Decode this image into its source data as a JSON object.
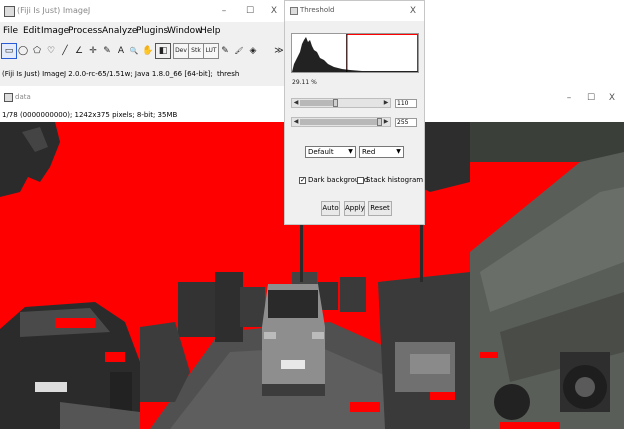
{
  "main_window": {
    "title": "(Fiji Is Just) ImageJ",
    "window_controls": {
      "minimize": "–",
      "maximize": "☐",
      "close": "X"
    },
    "menu": [
      "File",
      "Edit",
      "Image",
      "Process",
      "Analyze",
      "Plugins",
      "Window",
      "Help"
    ],
    "toolbar": {
      "tools": [
        {
          "name": "rectangle-tool-icon",
          "glyph": "▭"
        },
        {
          "name": "oval-tool-icon",
          "glyph": "◯"
        },
        {
          "name": "polygon-tool-icon",
          "glyph": "⬠"
        },
        {
          "name": "freehand-tool-icon",
          "glyph": "♡"
        },
        {
          "name": "line-tool-icon",
          "glyph": "╱"
        },
        {
          "name": "angle-tool-icon",
          "glyph": "∠"
        },
        {
          "name": "point-tool-icon",
          "glyph": "✛"
        },
        {
          "name": "wand-tool-icon",
          "glyph": "✎"
        },
        {
          "name": "text-tool-icon",
          "glyph": "A"
        },
        {
          "name": "magnifier-tool-icon",
          "glyph": "🔍"
        },
        {
          "name": "hand-tool-icon",
          "glyph": "✋"
        },
        {
          "name": "color-picker-tool-icon",
          "glyph": "◧"
        }
      ],
      "dev_label": "Dev",
      "stk_label": "Stk",
      "lut_label": "LUT",
      "pencil_glyph": "✎",
      "brush_glyph": "🖌",
      "flood_glyph": "◈",
      "more_glyph": "≫"
    },
    "status": {
      "version": "(Fiji Is Just) ImageJ 2.0.0-rc-65/1.51w; Java 1.8.0_66 [64-bit];",
      "tool": "thresh"
    }
  },
  "image_window": {
    "title": "data",
    "info": "1/78 (0000000000); 1242x375 pixels; 8-bit; 35MB",
    "window_controls": {
      "minimize": "–",
      "maximize": "☐",
      "close": "X"
    }
  },
  "threshold_dialog": {
    "title": "Threshold",
    "close": "X",
    "percentage": "29.11 %",
    "histogram": {
      "threshold_fraction_start": 0.435,
      "threshold_fraction_end": 1.0
    },
    "sliders": [
      {
        "value": "110",
        "position": 110,
        "max": 255
      },
      {
        "value": "255",
        "position": 255,
        "max": 255
      }
    ],
    "method": "Default",
    "display": "Red",
    "dark_background": {
      "label": "Dark background",
      "checked": true
    },
    "stack_histogram": {
      "label": "Stack histogram",
      "checked": false
    },
    "buttons": {
      "auto": "Auto",
      "apply": "Apply",
      "reset": "Reset"
    },
    "colors": {
      "threshold_red": "#ff0000",
      "histogram_fill": "#222222"
    }
  }
}
